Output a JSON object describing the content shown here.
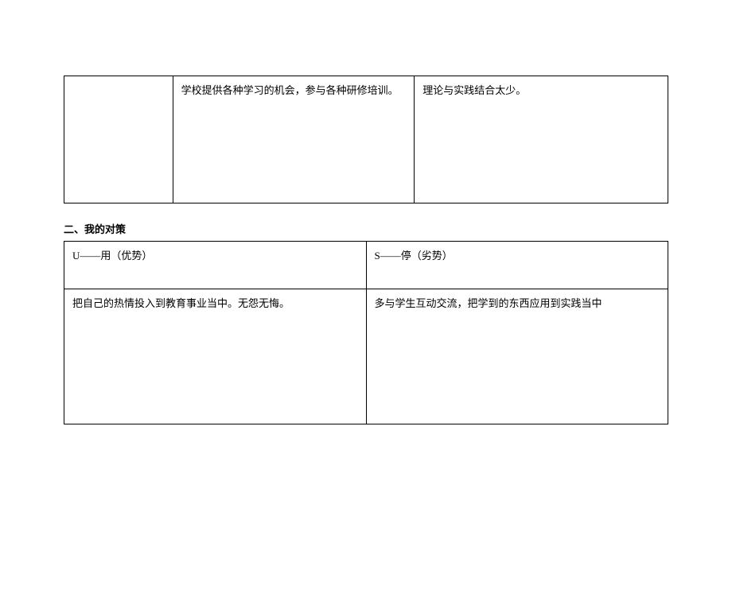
{
  "table1": {
    "row1": {
      "col1": "",
      "col2": "学校提供各种学习的机会，参与各种研修培训。",
      "col3": "理论与实践结合太少。"
    }
  },
  "section2": {
    "title": "二、我的对策"
  },
  "table2": {
    "header": {
      "left": "U——用（优势）",
      "right": "S——停（劣势）"
    },
    "content": {
      "left": "把自己的热情投入到教育事业当中。无怨无悔。",
      "right": "多与学生互动交流，把学到的东西应用到实践当中"
    }
  }
}
